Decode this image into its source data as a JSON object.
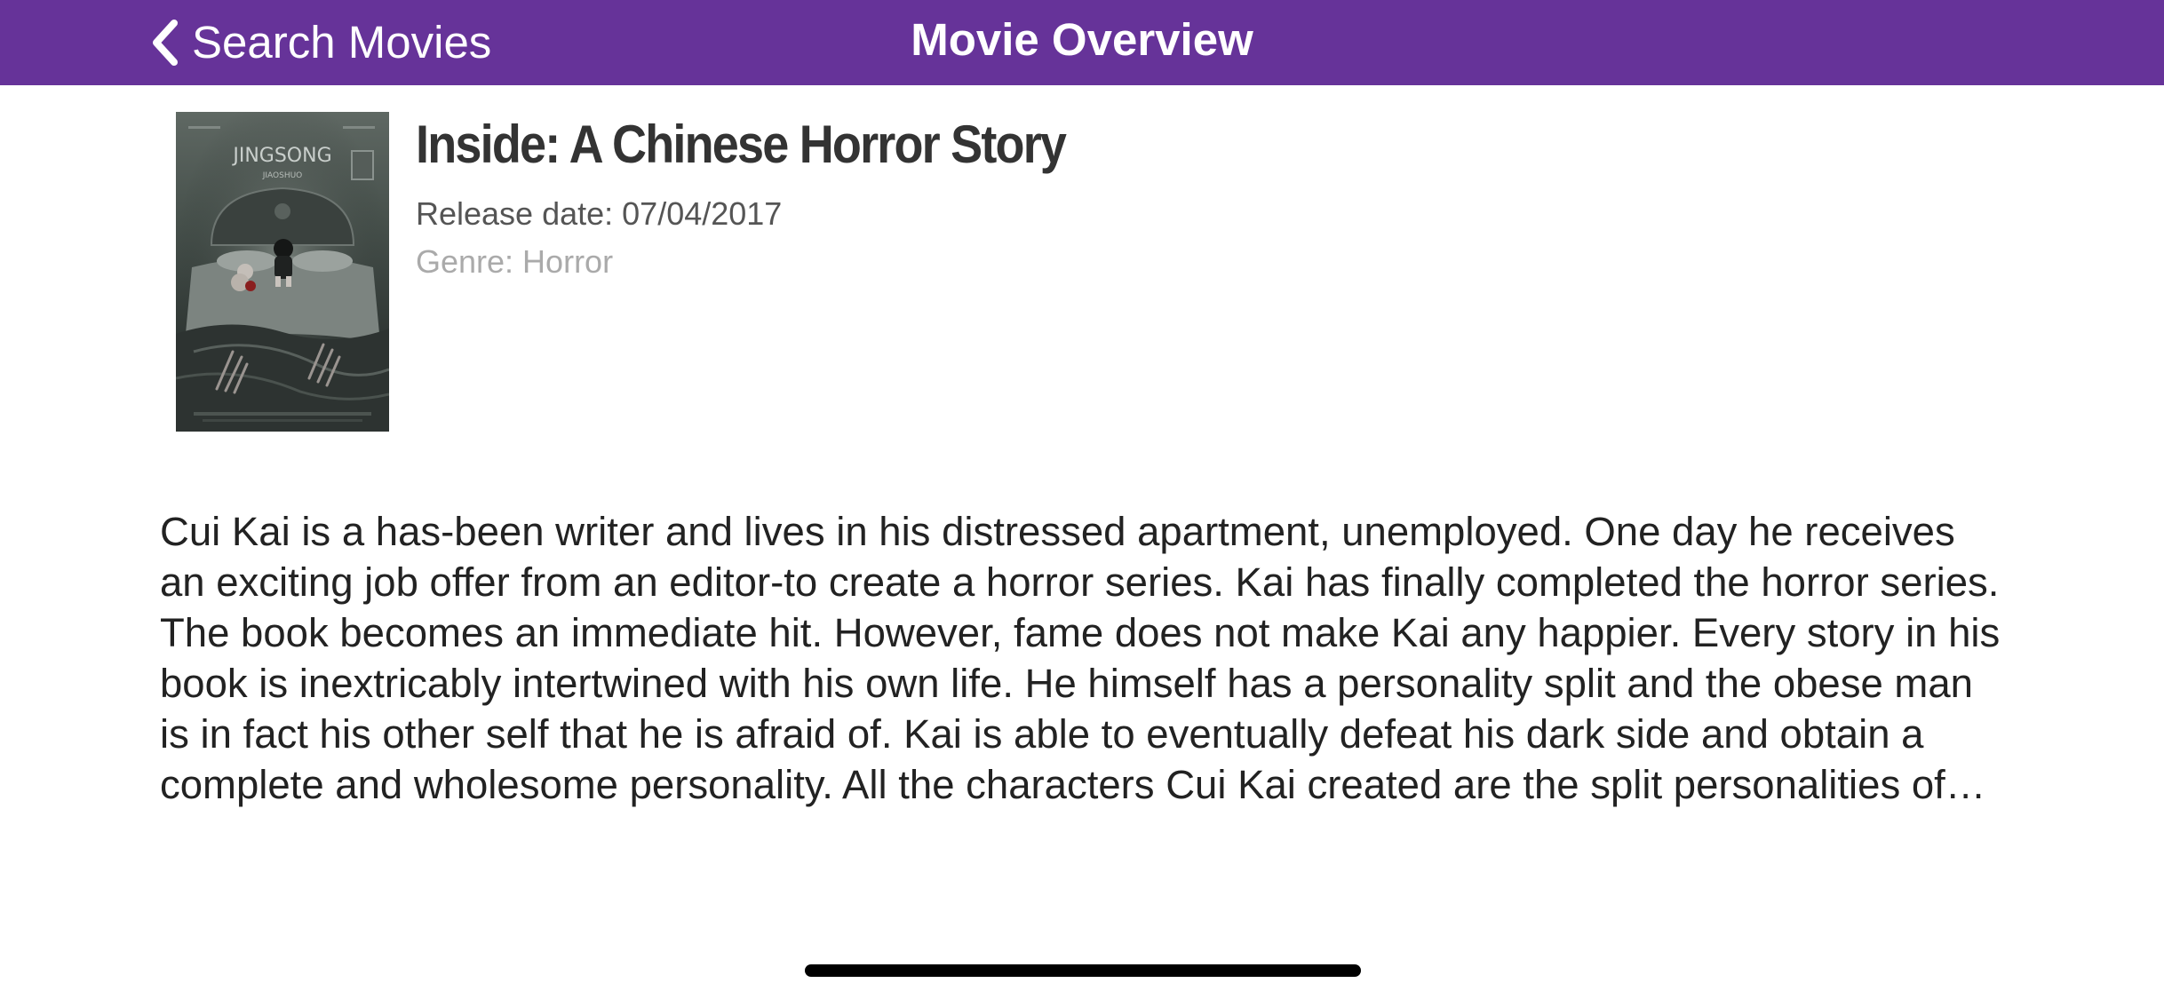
{
  "colors": {
    "navbar_background": "#663399",
    "navbar_text": "#ffffff",
    "title_text": "#333333",
    "release_text": "#555555",
    "genre_text": "#aaaaaa",
    "overview_text": "#222222"
  },
  "navbar": {
    "back_icon": "chevron-left-icon",
    "back_label": "Search Movies",
    "title": "Movie Overview"
  },
  "movie": {
    "poster": {
      "icon": "movie-poster-image",
      "title_text": "JINGSONG",
      "subtitle_text": "JIAOSHUO"
    },
    "title": "Inside: A Chinese Horror Story",
    "release_date": "Release date: 07/04/2017",
    "genre": "Genre: Horror",
    "overview": "Cui Kai is a has-been writer and lives in his distressed apartment, unemployed. One day he receives an exciting job offer from an editor-to create a horror series. Kai has finally completed the horror series. The book becomes an immediate hit. However, fame does not make Kai any happier. Every story in his book is inextricably intertwined with his own life. He himself has a personality split and the obese man is in fact his other self that he is afraid of. Kai is able to eventually defeat his dark side and obtain a complete and wholesome personality. All the characters Cui Kai created are the split personalities of himself during h…"
  }
}
